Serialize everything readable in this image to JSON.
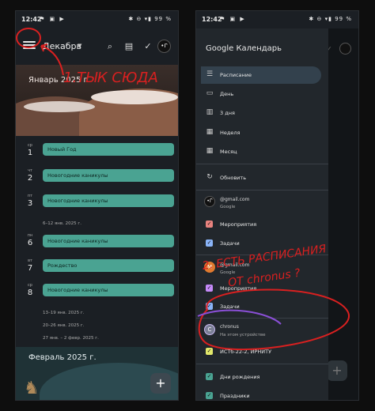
{
  "left": {
    "status": {
      "time": "12:42",
      "battery": "99 %"
    },
    "header": {
      "month": "Декабрь",
      "avatar": "•ᒋ"
    },
    "banner_label": "Январь 2025 г.",
    "days": [
      {
        "dow": "ср",
        "num": "1",
        "event": "Новый Год"
      },
      {
        "dow": "чт",
        "num": "2",
        "event": "Новогодние каникулы"
      },
      {
        "dow": "пт",
        "num": "3",
        "event": "Новогодние каникулы"
      },
      {
        "dow": "пн",
        "num": "6",
        "event": "Новогодние каникулы"
      },
      {
        "dow": "вт",
        "num": "7",
        "event": "Рождество"
      },
      {
        "dow": "ср",
        "num": "8",
        "event": "Новогодние каникулы"
      }
    ],
    "week_ranges": [
      "6–12 янв. 2025 г.",
      "13–19 янв. 2025 г.",
      "20–26 янв. 2025 г.",
      "27 янв. – 2 февр. 2025 г."
    ],
    "feb_title": "Февраль 2025 г.",
    "fab": "+"
  },
  "right": {
    "status": {
      "time": "12:42",
      "battery": "99 %"
    },
    "title": "Google Календарь",
    "views": [
      {
        "icon": "schedule-icon",
        "glyph": "☰",
        "label": "Расписание"
      },
      {
        "icon": "day-icon",
        "glyph": "▭",
        "label": "День"
      },
      {
        "icon": "three-day-icon",
        "glyph": "▥",
        "label": "3 дня"
      },
      {
        "icon": "week-icon",
        "glyph": "▦",
        "label": "Неделя"
      },
      {
        "icon": "month-icon",
        "glyph": "▦",
        "label": "Месяц"
      },
      {
        "icon": "refresh-icon",
        "glyph": "↻",
        "label": "Обновить"
      }
    ],
    "account1": {
      "email": "@gmail.com",
      "sub": "Google",
      "avatar": "•ᒋ"
    },
    "account1_cals": [
      {
        "label": "Мероприятия",
        "color": "#e8837f"
      },
      {
        "label": "Задачи",
        "color": "#8ab4f8"
      }
    ],
    "account2": {
      "email": "@gmail.com",
      "sub": "Google",
      "avatar": "M"
    },
    "account2_cals": [
      {
        "label": "Мероприятия",
        "color": "#c58af9"
      },
      {
        "label": "Задачи",
        "color": "#8ab4f8"
      }
    ],
    "account3": {
      "email": "chronus",
      "sub": "На этом устройстве",
      "avatar": "C"
    },
    "account3_cals": [
      {
        "label": "ИСТб-22-2, ИРНИТУ",
        "color": "#e2e86b"
      }
    ],
    "other_cals": [
      {
        "label": "Дни рождения",
        "color": "#4aa392"
      },
      {
        "label": "Праздники",
        "color": "#4aa392"
      }
    ]
  },
  "annotations": {
    "left": "1.ТЫК СЮДА",
    "right_line1": "2. ЕСТЬ РАСПИСАНИЯ",
    "right_line2": "ОТ chronus ?"
  }
}
